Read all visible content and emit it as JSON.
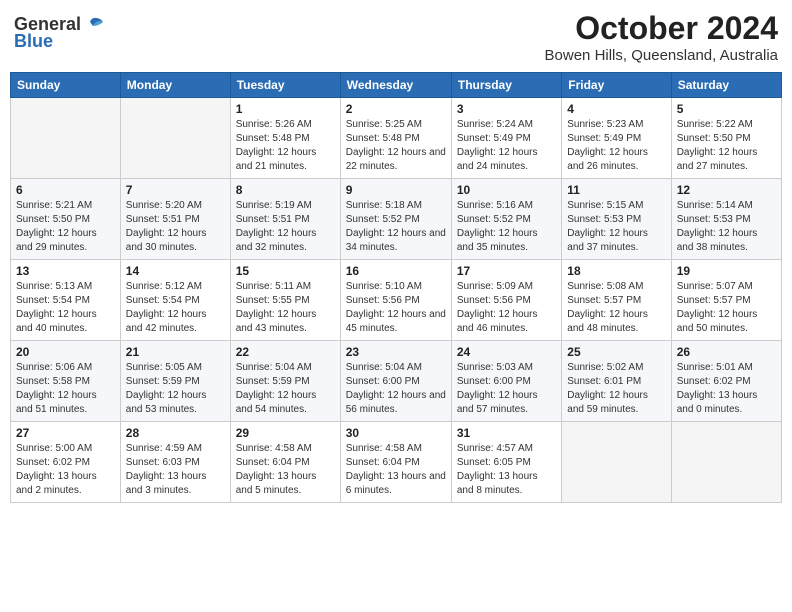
{
  "header": {
    "logo_general": "General",
    "logo_blue": "Blue",
    "title": "October 2024",
    "location": "Bowen Hills, Queensland, Australia"
  },
  "days_of_week": [
    "Sunday",
    "Monday",
    "Tuesday",
    "Wednesday",
    "Thursday",
    "Friday",
    "Saturday"
  ],
  "weeks": [
    [
      {
        "day": "",
        "info": ""
      },
      {
        "day": "",
        "info": ""
      },
      {
        "day": "1",
        "info": "Sunrise: 5:26 AM\nSunset: 5:48 PM\nDaylight: 12 hours and 21 minutes."
      },
      {
        "day": "2",
        "info": "Sunrise: 5:25 AM\nSunset: 5:48 PM\nDaylight: 12 hours and 22 minutes."
      },
      {
        "day": "3",
        "info": "Sunrise: 5:24 AM\nSunset: 5:49 PM\nDaylight: 12 hours and 24 minutes."
      },
      {
        "day": "4",
        "info": "Sunrise: 5:23 AM\nSunset: 5:49 PM\nDaylight: 12 hours and 26 minutes."
      },
      {
        "day": "5",
        "info": "Sunrise: 5:22 AM\nSunset: 5:50 PM\nDaylight: 12 hours and 27 minutes."
      }
    ],
    [
      {
        "day": "6",
        "info": "Sunrise: 5:21 AM\nSunset: 5:50 PM\nDaylight: 12 hours and 29 minutes."
      },
      {
        "day": "7",
        "info": "Sunrise: 5:20 AM\nSunset: 5:51 PM\nDaylight: 12 hours and 30 minutes."
      },
      {
        "day": "8",
        "info": "Sunrise: 5:19 AM\nSunset: 5:51 PM\nDaylight: 12 hours and 32 minutes."
      },
      {
        "day": "9",
        "info": "Sunrise: 5:18 AM\nSunset: 5:52 PM\nDaylight: 12 hours and 34 minutes."
      },
      {
        "day": "10",
        "info": "Sunrise: 5:16 AM\nSunset: 5:52 PM\nDaylight: 12 hours and 35 minutes."
      },
      {
        "day": "11",
        "info": "Sunrise: 5:15 AM\nSunset: 5:53 PM\nDaylight: 12 hours and 37 minutes."
      },
      {
        "day": "12",
        "info": "Sunrise: 5:14 AM\nSunset: 5:53 PM\nDaylight: 12 hours and 38 minutes."
      }
    ],
    [
      {
        "day": "13",
        "info": "Sunrise: 5:13 AM\nSunset: 5:54 PM\nDaylight: 12 hours and 40 minutes."
      },
      {
        "day": "14",
        "info": "Sunrise: 5:12 AM\nSunset: 5:54 PM\nDaylight: 12 hours and 42 minutes."
      },
      {
        "day": "15",
        "info": "Sunrise: 5:11 AM\nSunset: 5:55 PM\nDaylight: 12 hours and 43 minutes."
      },
      {
        "day": "16",
        "info": "Sunrise: 5:10 AM\nSunset: 5:56 PM\nDaylight: 12 hours and 45 minutes."
      },
      {
        "day": "17",
        "info": "Sunrise: 5:09 AM\nSunset: 5:56 PM\nDaylight: 12 hours and 46 minutes."
      },
      {
        "day": "18",
        "info": "Sunrise: 5:08 AM\nSunset: 5:57 PM\nDaylight: 12 hours and 48 minutes."
      },
      {
        "day": "19",
        "info": "Sunrise: 5:07 AM\nSunset: 5:57 PM\nDaylight: 12 hours and 50 minutes."
      }
    ],
    [
      {
        "day": "20",
        "info": "Sunrise: 5:06 AM\nSunset: 5:58 PM\nDaylight: 12 hours and 51 minutes."
      },
      {
        "day": "21",
        "info": "Sunrise: 5:05 AM\nSunset: 5:59 PM\nDaylight: 12 hours and 53 minutes."
      },
      {
        "day": "22",
        "info": "Sunrise: 5:04 AM\nSunset: 5:59 PM\nDaylight: 12 hours and 54 minutes."
      },
      {
        "day": "23",
        "info": "Sunrise: 5:04 AM\nSunset: 6:00 PM\nDaylight: 12 hours and 56 minutes."
      },
      {
        "day": "24",
        "info": "Sunrise: 5:03 AM\nSunset: 6:00 PM\nDaylight: 12 hours and 57 minutes."
      },
      {
        "day": "25",
        "info": "Sunrise: 5:02 AM\nSunset: 6:01 PM\nDaylight: 12 hours and 59 minutes."
      },
      {
        "day": "26",
        "info": "Sunrise: 5:01 AM\nSunset: 6:02 PM\nDaylight: 13 hours and 0 minutes."
      }
    ],
    [
      {
        "day": "27",
        "info": "Sunrise: 5:00 AM\nSunset: 6:02 PM\nDaylight: 13 hours and 2 minutes."
      },
      {
        "day": "28",
        "info": "Sunrise: 4:59 AM\nSunset: 6:03 PM\nDaylight: 13 hours and 3 minutes."
      },
      {
        "day": "29",
        "info": "Sunrise: 4:58 AM\nSunset: 6:04 PM\nDaylight: 13 hours and 5 minutes."
      },
      {
        "day": "30",
        "info": "Sunrise: 4:58 AM\nSunset: 6:04 PM\nDaylight: 13 hours and 6 minutes."
      },
      {
        "day": "31",
        "info": "Sunrise: 4:57 AM\nSunset: 6:05 PM\nDaylight: 13 hours and 8 minutes."
      },
      {
        "day": "",
        "info": ""
      },
      {
        "day": "",
        "info": ""
      }
    ]
  ]
}
